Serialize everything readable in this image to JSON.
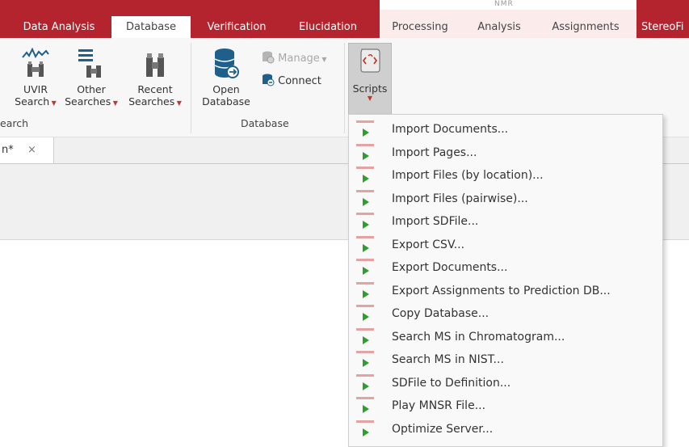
{
  "ribbon_tabs": {
    "data_analysis": "Data Analysis",
    "database": "Database",
    "verification": "Verification",
    "elucidation": "Elucidation",
    "processing": "Processing",
    "analysis": "Analysis",
    "assignments": "Assignments",
    "stereo": "StereoFi"
  },
  "contextual_group": "NMR",
  "search_group": {
    "uvir": [
      "UVIR",
      "Search"
    ],
    "other": [
      "Other",
      "Searches"
    ],
    "recent": [
      "Recent",
      "Searches"
    ],
    "label": "earch"
  },
  "database_group": {
    "open": [
      "Open",
      "Database"
    ],
    "manage": "Manage",
    "connect": "Connect",
    "label": "Database"
  },
  "scripts_button": "Scripts",
  "document_tab": {
    "title": "n*",
    "close": "×"
  },
  "scripts_menu": [
    "Import Documents...",
    "Import Pages...",
    "Import Files (by location)...",
    "Import Files (pairwise)...",
    "Import SDFile...",
    "Export CSV...",
    "Export Documents...",
    "Export Assignments to Prediction DB...",
    "Copy Database...",
    "Search MS in Chromatogram...",
    "Search MS in NIST...",
    "SDFile to Definition...",
    "Play MNSR File...",
    "Optimize Server..."
  ],
  "colors": {
    "ribbon_red": "#b3242f",
    "context_pink": "#fbeceb",
    "play_green": "#2e9e2e",
    "db_icon_blue": "#1f5f8b"
  },
  "icons": {
    "uvir": "uvir-spectrum-binoculars-icon",
    "other": "list-binoculars-icon",
    "recent": "binoculars-icon",
    "open": "database-open-icon",
    "manage": "database-gear-icon",
    "connect": "database-connect-icon",
    "scripts": "script-scroll-icon",
    "menu_item": "script-play-icon"
  }
}
